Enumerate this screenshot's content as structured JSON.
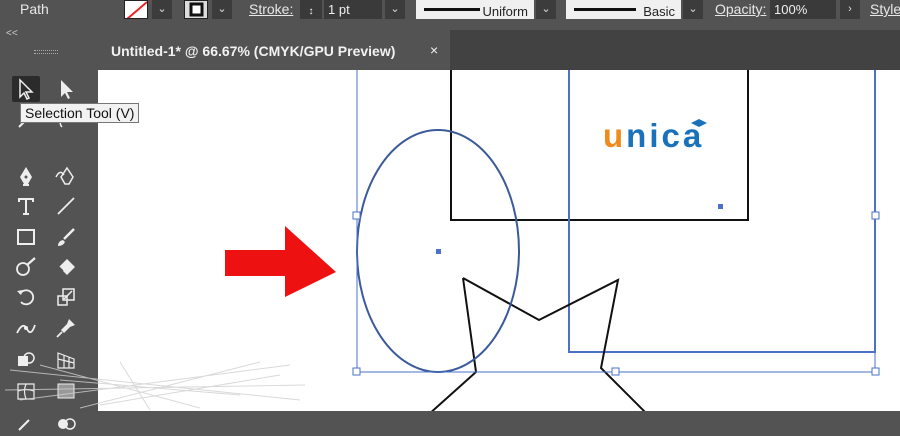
{
  "control_bar": {
    "path_label": "Path",
    "stroke_label": "Stroke:",
    "stroke_weight": "1 pt",
    "variable_width_profile": "Uniform",
    "brush_definition": "Basic",
    "opacity_label": "Opacity:",
    "opacity_value": "100%",
    "style_label": "Style"
  },
  "document_tab": {
    "title": "Untitled-1* @ 66.67% (CMYK/GPU Preview)",
    "close_glyph": "×"
  },
  "tool_panel": {
    "collapse_glyph": "<<",
    "tooltip": "Selection Tool (V)",
    "tools": [
      "selection-tool",
      "direct-selection-tool",
      "magic-wand-tool",
      "lasso-tool",
      "pen-tool",
      "curvature-tool",
      "type-tool",
      "line-segment-tool",
      "rectangle-tool",
      "paintbrush-tool",
      "shaper-tool",
      "eraser-tool",
      "rotate-tool",
      "scale-tool",
      "width-tool",
      "free-transform-tool",
      "shape-builder-tool",
      "perspective-grid-tool",
      "mesh-tool",
      "gradient-tool"
    ]
  },
  "canvas": {
    "logo": {
      "first_letter": "u",
      "rest": "nica"
    },
    "colors": {
      "selection": "#4a72c8",
      "ellipse_stroke": "#3b5a9a",
      "arrow": "#ee1111",
      "logo_orange": "#f08a1c",
      "logo_blue": "#1a73ba"
    }
  }
}
